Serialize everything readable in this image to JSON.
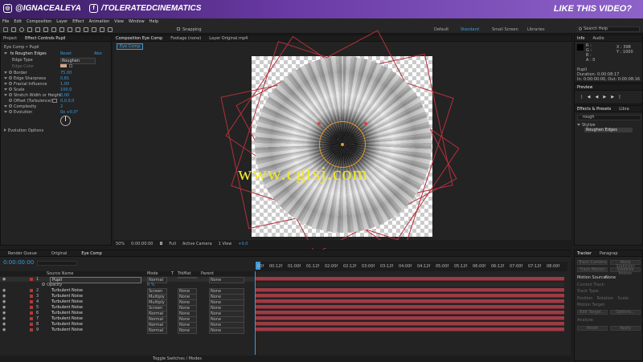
{
  "banner": {
    "left_handle": "@IGNACEALEYA",
    "right_handle": "/TOLERATEDCINEMATICS",
    "cta": "LIKE THIS VIDEO?",
    "left_icon": "instagram-icon",
    "right_icon": "facebook-icon"
  },
  "menu": [
    "File",
    "Edit",
    "Composition",
    "Layer",
    "Effect",
    "Animation",
    "View",
    "Window",
    "Help"
  ],
  "toolbar": {
    "snapping": "Snapping",
    "workspaces": [
      "Default",
      "Standard",
      "Small Screen",
      "Libraries"
    ],
    "search_placeholder": "Search Help"
  },
  "left_panel": {
    "tabs": [
      "Project",
      "Effect Controls Pupil"
    ],
    "breadcrumb": "Eye Comp • Pupil",
    "effect": {
      "name": "Roughen Edges",
      "reset": "Reset",
      "about": "Abo"
    },
    "rows": [
      {
        "label": "Edge Type",
        "value": "Roughen"
      },
      {
        "label": "Edge Color",
        "value": ""
      },
      {
        "label": "Border",
        "value": "75,00"
      },
      {
        "label": "Edge Sharpness",
        "value": "0,81"
      },
      {
        "label": "Fractal Influence",
        "value": "1,00"
      },
      {
        "label": "Scale",
        "value": "100,0"
      },
      {
        "label": "Stretch Width or Height",
        "value": "0,00"
      },
      {
        "label": "Offset (Turbulence)",
        "value": "0,0,0,0"
      },
      {
        "label": "Complexity",
        "value": "2"
      },
      {
        "label": "Evolution",
        "value": "0x +0,0°"
      },
      {
        "label": "Evolution Options",
        "value": ""
      }
    ]
  },
  "viewer": {
    "tabs": [
      "Composition Eye Comp",
      "Footage (none)",
      "Layer Original.mp4"
    ],
    "comp_tab": "Eye Comp",
    "watermark": "www.cgtsj.com",
    "footer": {
      "zoom": "50%",
      "timecode": "0:00:00:00",
      "quality": "Full",
      "camera": "Active Camera",
      "views": "1 View",
      "exposure": "+0,0"
    }
  },
  "info": {
    "tabs": [
      "Info",
      "Audio"
    ],
    "r": "R :",
    "g": "G :",
    "b": "B :",
    "a": "A : 0",
    "x": "X : 398",
    "y": "Y : 1000",
    "layer": "Pupil",
    "duration": "Duration: 0:00:08:17",
    "in": "In: 0:00:00:00, Out: 0:00:08:16"
  },
  "preview": {
    "title": "Preview"
  },
  "effects_presets": {
    "tabs": [
      "Effects & Presets",
      "Libra"
    ],
    "search": "rough",
    "category": "Stylize",
    "item": "Roughen Edges"
  },
  "timeline": {
    "tabs": [
      "Render Queue",
      "Original",
      "Eye Comp"
    ],
    "timecode": "0:00:00:00",
    "columns": [
      "Source Name",
      "Mode",
      "T",
      "TrkMat",
      "Parent"
    ],
    "ruler": [
      "00f",
      "00:12f",
      "01:00f",
      "01:12f",
      "02:00f",
      "02:12f",
      "03:00f",
      "03:12f",
      "04:00f",
      "04:12f",
      "05:00f",
      "05:12f",
      "06:00f",
      "06:12f",
      "07:00f",
      "07:12f",
      "08:00f"
    ],
    "layers": [
      {
        "num": "1",
        "name": "Pupil",
        "mode": "Normal",
        "trkmat": "",
        "parent": "None"
      },
      {
        "num": "",
        "name": "Opacity",
        "mode": "",
        "trkmat": "",
        "parent": "",
        "value": "0 %"
      },
      {
        "num": "2",
        "name": "Turbulent Noise",
        "mode": "Screen",
        "trkmat": "None",
        "parent": "None"
      },
      {
        "num": "3",
        "name": "Turbulent Noise",
        "mode": "Multiply",
        "trkmat": "None",
        "parent": "None"
      },
      {
        "num": "4",
        "name": "Turbulent Noise",
        "mode": "Multiply",
        "trkmat": "None",
        "parent": "None"
      },
      {
        "num": "5",
        "name": "Turbulent Noise",
        "mode": "Screen",
        "trkmat": "None",
        "parent": "None"
      },
      {
        "num": "6",
        "name": "Turbulent Noise",
        "mode": "Normal",
        "trkmat": "None",
        "parent": "None"
      },
      {
        "num": "7",
        "name": "Turbulent Noise",
        "mode": "Normal",
        "trkmat": "None",
        "parent": "None"
      },
      {
        "num": "8",
        "name": "Turbulent Noise",
        "mode": "Normal",
        "trkmat": "None",
        "parent": "None"
      },
      {
        "num": "9",
        "name": "Turbulent Noise",
        "mode": "Normal",
        "trkmat": "None",
        "parent": "None"
      }
    ],
    "footer": "Toggle Switches / Modes"
  },
  "tracker": {
    "tabs": [
      "Tracker",
      "Paragrap"
    ],
    "buttons": [
      "Track Camera",
      "Warp Stabilizer",
      "Track Motion",
      "Stabilize Motion"
    ],
    "motion_source_label": "Motion Source:",
    "motion_source": "None",
    "current_track": "Current Track:",
    "track_type": "Track Type:",
    "checks": [
      "Position",
      "Rotation",
      "Scale"
    ],
    "motion_target": "Motion Target:",
    "edit_target": "Edit Target...",
    "options": "Options...",
    "analyze": "Analyze:",
    "reset": "Reset",
    "apply": "Apply"
  },
  "colors": {
    "accent": "#3c9bdc",
    "layer_bar": "#9c3c46",
    "banner": "#6a3aa5",
    "mask": "#e69a2c"
  }
}
